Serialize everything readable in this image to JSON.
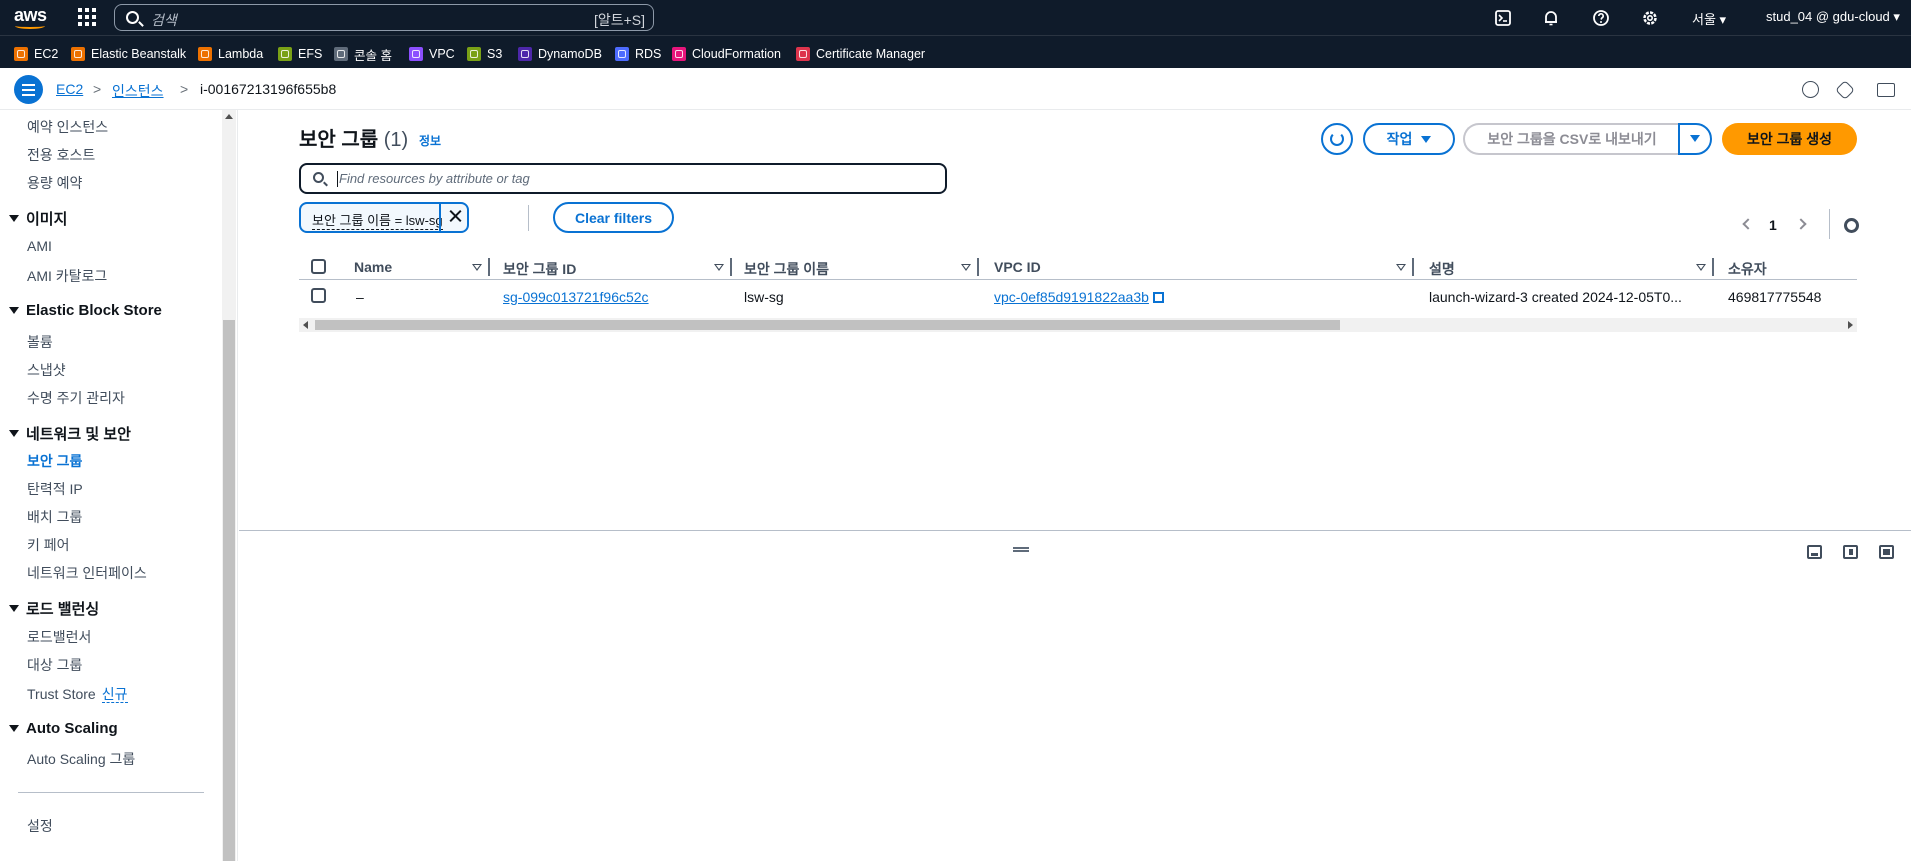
{
  "topnav": {
    "logo": "aws",
    "search_placeholder": "검색",
    "search_shortcut": "[알트+S]",
    "icons": [
      "cloudshell-icon",
      "bell-icon",
      "help-icon",
      "gear-icon"
    ],
    "region": "서울 ▾",
    "user": "stud_04 @ gdu-cloud ▾"
  },
  "favorites": [
    {
      "label": "EC2",
      "color": "#ed7100"
    },
    {
      "label": "Elastic Beanstalk",
      "color": "#ed7100"
    },
    {
      "label": "Lambda",
      "color": "#ed7100"
    },
    {
      "label": "EFS",
      "color": "#7aa116"
    },
    {
      "label": "콘솔 홈",
      "color": "#5f6b7a"
    },
    {
      "label": "VPC",
      "color": "#8c4fff"
    },
    {
      "label": "S3",
      "color": "#7aa116"
    },
    {
      "label": "DynamoDB",
      "color": "#4d27aa"
    },
    {
      "label": "RDS",
      "color": "#4d6bfe"
    },
    {
      "label": "CloudFormation",
      "color": "#e7157b"
    },
    {
      "label": "Certificate Manager",
      "color": "#dd344c"
    }
  ],
  "breadcrumb": {
    "items": [
      "EC2",
      "인스턴스",
      "i-00167213196f655b8"
    ],
    "separator": ">"
  },
  "sidebar": {
    "items": [
      {
        "label": "예약 인스턴스"
      },
      {
        "label": "전용 호스트"
      },
      {
        "label": "용량 예약"
      }
    ],
    "section_images": {
      "title": "이미지",
      "items": [
        "AMI",
        "AMI 카탈로그"
      ]
    },
    "section_ebs": {
      "title": "Elastic Block Store",
      "items": [
        "볼륨",
        "스냅샷",
        "수명 주기 관리자"
      ]
    },
    "section_network": {
      "title": "네트워크 및 보안",
      "items": [
        "보안 그룹",
        "탄력적 IP",
        "배치 그룹",
        "키 페어",
        "네트워크 인터페이스"
      ]
    },
    "section_lb": {
      "title": "로드 밸런싱",
      "items": [
        "로드밸런서",
        "대상 그룹",
        "Trust Store"
      ],
      "new_badge": "신규"
    },
    "section_as": {
      "title": "Auto Scaling",
      "items": [
        "Auto Scaling 그룹"
      ]
    },
    "settings": "설정"
  },
  "main": {
    "title": "보안 그룹",
    "count": "(1)",
    "info": "정보",
    "actions_label": "작업",
    "export_label": "보안 그룹을 CSV로 내보내기",
    "create_label": "보안 그룹 생성",
    "filter_placeholder": "Find resources by attribute or tag",
    "token": "보안 그룹 이름 = lsw-sg",
    "clear_filters": "Clear filters",
    "page": "1"
  },
  "table": {
    "columns": [
      "Name",
      "보안 그룹 ID",
      "보안 그룹 이름",
      "VPC ID",
      "설명",
      "소유자"
    ],
    "rows": [
      {
        "name": "–",
        "sg_id": "sg-099c013721f96c52c",
        "sg_name": "lsw-sg",
        "vpc_id": "vpc-0ef85d9191822aa3b",
        "description": "launch-wizard-3 created 2024-12-05T0...",
        "owner": "469817775548"
      }
    ]
  },
  "colors": {
    "nav_bg": "#0f1b2a",
    "link": "#0972d3",
    "primary": "#ff9900"
  }
}
